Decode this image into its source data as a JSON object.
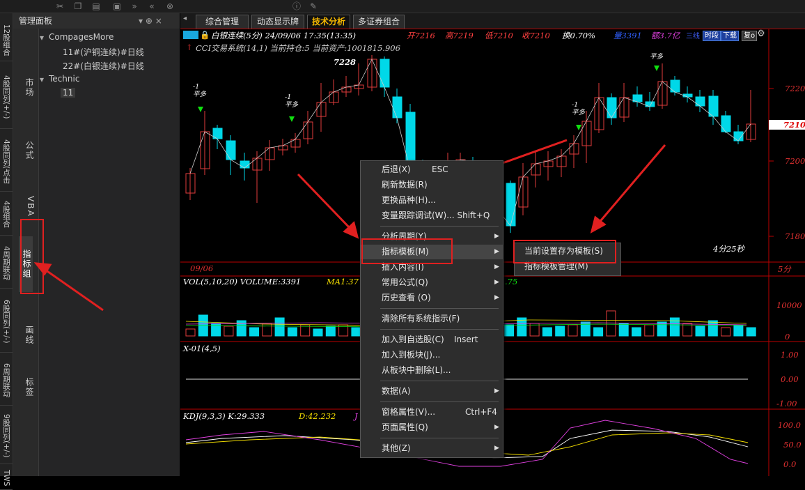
{
  "toolbar": {
    "icons": [
      "cut-icon",
      "copy-icon",
      "paste-icon",
      "save-icon",
      "forward-icon",
      "back-icon",
      "close-circle-icon",
      "info-icon",
      "pen-icon"
    ]
  },
  "vstrip": {
    "tabs": [
      "12股组合",
      "4股同列(+/-)",
      "4股同列(点击",
      "4股组合",
      "4周期联动",
      "6股同列(+/-)",
      "6周期联动",
      "9股同列(+/-)",
      "TWS多"
    ]
  },
  "panel": {
    "title": "管理面板",
    "pin": "▾ ⊕ ×",
    "side_tabs": [
      "市场",
      "公式",
      "VBA",
      "指标组",
      "画线",
      "标签"
    ],
    "tree": [
      {
        "label": "CompagesMore",
        "children": [
          "11#(沪铜连续)#日线",
          "22#(白银连续)#日线"
        ]
      },
      {
        "label": "Technic",
        "children": [
          "11"
        ]
      }
    ]
  },
  "chart": {
    "tabs": [
      "综合管理",
      "动态显示牌",
      "技术分析",
      "多证券组合"
    ],
    "active_tab": "技术分析",
    "header_title": "白银连续(5分) 24/09/06  17:35(13:35)",
    "header_open": "开7216",
    "header_high": "高7219",
    "header_low": "低7210",
    "header_close": "收7210",
    "header_change": "换0.70%",
    "header_vol": "量3391",
    "header_amount": "额3.7亿",
    "header_extra": "三线",
    "btn_time": "时段",
    "btn_down": "下载",
    "btn_close": "复o",
    "cci_line": "CCI交易系统(14,1)  当前持仓:5  当前资产:1001815.906",
    "peak_label": "7228",
    "signals": [
      "-1\n平多",
      "-1\n平多",
      "-1\n平多",
      "平多"
    ],
    "price_ticks": [
      "7220",
      "7210",
      "7200",
      "7180"
    ],
    "price_current": "7210",
    "countdown": "4分25秒",
    "date_label": "09/06",
    "period_label": "5分",
    "vol_title": "VOL(5,10,20) VOLUME:3391",
    "vol_ma1": "MA1:37",
    "vol_end": ".75",
    "vol_tick": "10000",
    "vol_zero": "0",
    "x01_title": "X-01(4,5)",
    "x01_ticks": [
      "1.00",
      "0.00",
      "-1.00"
    ],
    "kdj_title": "KDJ(9,3,3) K:29.333",
    "kdj_d": "D:42.232",
    "kdj_j": "J",
    "kdj_ticks": [
      "100.0",
      "50.0",
      "0.0"
    ]
  },
  "menu": {
    "items": [
      {
        "label": "后退(X)",
        "shortcut": "ESC"
      },
      {
        "label": "刷新数据(R)",
        "shortcut": ""
      },
      {
        "label": "更换品种(H)...",
        "shortcut": ""
      },
      {
        "label": "变量跟踪调试(W)... Shift+Q",
        "shortcut": ""
      },
      {
        "label": "分析周期(Y)",
        "shortcut": "",
        "arrow": true
      },
      {
        "label": "指标模板(M)",
        "shortcut": "",
        "arrow": true
      },
      {
        "label": "插入内容(I)",
        "shortcut": "",
        "arrow": true
      },
      {
        "label": "常用公式(Q)",
        "shortcut": "",
        "arrow": true
      },
      {
        "label": "历史查看 (O)",
        "shortcut": "",
        "arrow": true
      },
      {
        "label": "清除所有系统指示(F)",
        "shortcut": ""
      },
      {
        "label": "加入到自选股(C)",
        "shortcut": "Insert"
      },
      {
        "label": "加入到板块(J)...",
        "shortcut": ""
      },
      {
        "label": "从板块中删除(L)...",
        "shortcut": ""
      },
      {
        "label": "数据(A)",
        "shortcut": "",
        "arrow": true
      },
      {
        "label": "窗格属性(V)...",
        "shortcut": "Ctrl+F4"
      },
      {
        "label": "页面属性(Q)",
        "shortcut": "",
        "arrow": true
      },
      {
        "label": "其他(Z)",
        "shortcut": "",
        "arrow": true
      }
    ],
    "submenu": [
      "当前设置存为模板(S)",
      "指标模板管理(M)"
    ]
  },
  "colors": {
    "up": "#e23c3c",
    "down": "#00d8e8",
    "accent": "#e02020",
    "active_tab": "#f6b800",
    "signal": "#10e010"
  }
}
